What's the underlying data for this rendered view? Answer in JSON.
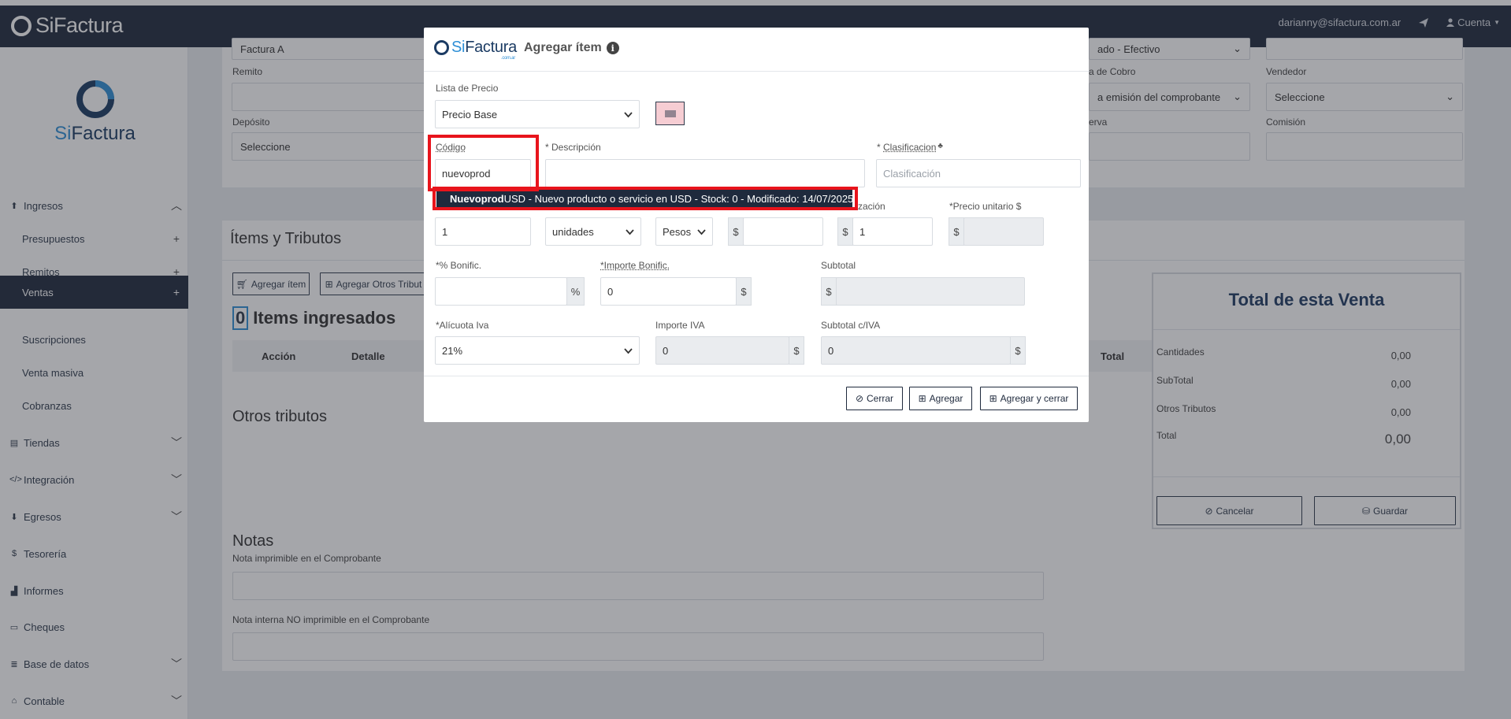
{
  "topbar": {
    "brand": "SiFactura",
    "user_email": "darianny@sifactura.com.ar",
    "account_label": "Cuenta"
  },
  "sidebar": {
    "logo_text_a": "Si",
    "logo_text_b": "Factura",
    "items": [
      {
        "label": "Ingresos"
      },
      {
        "label": "Presupuestos"
      },
      {
        "label": "Remitos"
      },
      {
        "label": "Ventas"
      },
      {
        "label": "Suscripciones"
      },
      {
        "label": "Venta masiva"
      },
      {
        "label": "Cobranzas"
      },
      {
        "label": "Tiendas"
      },
      {
        "label": "Integración"
      },
      {
        "label": "Egresos"
      },
      {
        "label": "Tesorería"
      },
      {
        "label": "Informes"
      },
      {
        "label": "Cheques"
      },
      {
        "label": "Base de datos"
      },
      {
        "label": "Contable"
      }
    ]
  },
  "form": {
    "tipo_value": "Factura A",
    "remito_label": "Remito",
    "deposito_label": "Depósito",
    "deposito_value": "Seleccione",
    "medio_value": "ado - Efectivo",
    "cobro_label": "a de Cobro",
    "cobro_value": "a emisión del comprobante",
    "vendedor_label": "Vendedor",
    "vendedor_value": "Seleccione",
    "reserva_label": "erva",
    "comision_label": "Comisión"
  },
  "items_section": {
    "title": "Ítems y Tributos",
    "add_item": "Agregar ítem",
    "add_otros": "Agregar Otros Tribut",
    "count": "0",
    "count_label": "Items ingresados",
    "col_accion": "Acción",
    "col_detalle": "Detalle",
    "col_total": "Total",
    "otros_title": "Otros tributos"
  },
  "notas": {
    "title": "Notas",
    "imprimible": "Nota imprimible en el Comprobante",
    "interna": "Nota interna NO imprimible en el Comprobante"
  },
  "total_panel": {
    "title": "Total de esta Venta",
    "rows": [
      {
        "label": "Cantidades",
        "value": "0,00"
      },
      {
        "label": "SubTotal",
        "value": "0,00"
      },
      {
        "label": "Otros Tributos",
        "value": "0,00"
      },
      {
        "label": "Total",
        "value": "0,00"
      }
    ],
    "cancel": "Cancelar",
    "save": "Guardar"
  },
  "modal": {
    "logo_a": "Si",
    "logo_b": "Factura",
    "logo_sub": ".com.ar",
    "title": "Agregar ítem",
    "lista_label": "Lista de Precio",
    "lista_value": "Precio Base",
    "codigo_label": "Código",
    "codigo_value": "nuevoprod",
    "descripcion_label": "* Descripción",
    "clasificacion_label": "Clasificacion",
    "clasificacion_prefix": "* ",
    "clasificacion_placeholder": "Clasificación",
    "suggestion_bold": "Nuevoprod",
    "suggestion_rest": "USD - Nuevo producto o servicio en USD - Stock: 0 - Modificado: 14/07/2025",
    "cotizacion_label": "zación",
    "precio_label": "*Precio unitario $",
    "cantidad_value": "1",
    "unidad_value": "unidades",
    "moneda_value": "Pesos",
    "currency_symbol": "$",
    "cotizacion_value": "1",
    "bonif_pct_label": "*% Bonific.",
    "pct_symbol": "%",
    "bonif_imp_label": "*Importe Bonific.",
    "bonif_imp_value": "0",
    "subtotal_label": "Subtotal",
    "alicuota_label": "*Alícuota Iva",
    "alicuota_value": "21%",
    "importe_iva_label": "Importe IVA",
    "importe_iva_value": "0",
    "subtotal_iva_label": "Subtotal c/IVA",
    "subtotal_iva_value": "0",
    "btn_cerrar": "Cerrar",
    "btn_agregar": "Agregar",
    "btn_agregar_cerrar": "Agregar y cerrar"
  },
  "colors": {
    "navy": "#1f2a3d",
    "accent_blue": "#2f8fd6",
    "highlight_red": "#e8141c"
  }
}
